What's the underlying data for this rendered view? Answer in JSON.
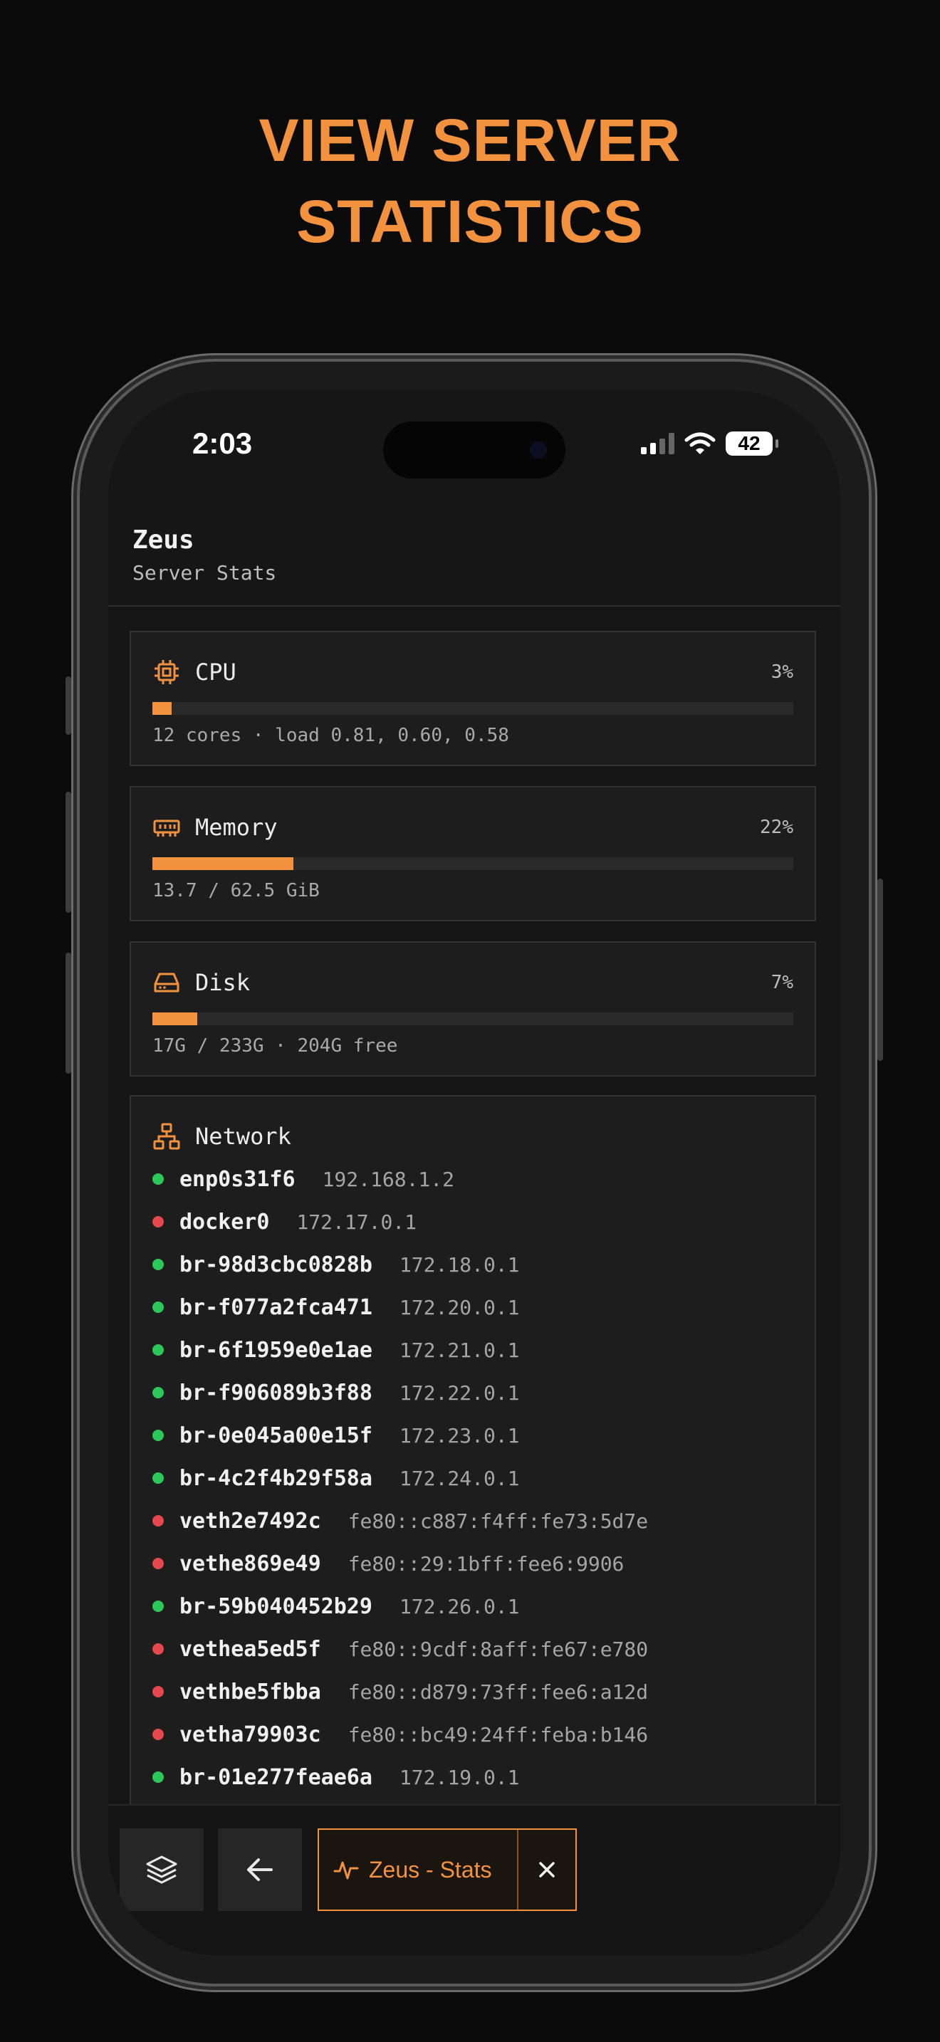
{
  "headline": {
    "line1": "VIEW SERVER",
    "line2": "STATISTICS"
  },
  "status_bar": {
    "time": "2:03",
    "battery": "42"
  },
  "app": {
    "title": "Zeus",
    "subtitle": "Server Stats"
  },
  "cpu": {
    "label": "CPU",
    "percent_text": "3%",
    "percent": 3,
    "detail": "12 cores · load 0.81, 0.60, 0.58"
  },
  "memory": {
    "label": "Memory",
    "percent_text": "22%",
    "percent": 22,
    "detail": "13.7 / 62.5 GiB"
  },
  "disk": {
    "label": "Disk",
    "percent_text": "7%",
    "percent": 7,
    "detail": "17G / 233G · 204G free"
  },
  "network": {
    "label": "Network",
    "interfaces": [
      {
        "name": "enp0s31f6",
        "address": "192.168.1.2",
        "status": "up"
      },
      {
        "name": "docker0",
        "address": "172.17.0.1",
        "status": "down"
      },
      {
        "name": "br-98d3cbc0828b",
        "address": "172.18.0.1",
        "status": "up"
      },
      {
        "name": "br-f077a2fca471",
        "address": "172.20.0.1",
        "status": "up"
      },
      {
        "name": "br-6f1959e0e1ae",
        "address": "172.21.0.1",
        "status": "up"
      },
      {
        "name": "br-f906089b3f88",
        "address": "172.22.0.1",
        "status": "up"
      },
      {
        "name": "br-0e045a00e15f",
        "address": "172.23.0.1",
        "status": "up"
      },
      {
        "name": "br-4c2f4b29f58a",
        "address": "172.24.0.1",
        "status": "up"
      },
      {
        "name": "veth2e7492c",
        "address": "fe80::c887:f4ff:fe73:5d7e",
        "status": "down"
      },
      {
        "name": "vethe869e49",
        "address": "fe80::29:1bff:fee6:9906",
        "status": "down"
      },
      {
        "name": "br-59b040452b29",
        "address": "172.26.0.1",
        "status": "up"
      },
      {
        "name": "vethea5ed5f",
        "address": "fe80::9cdf:8aff:fe67:e780",
        "status": "down"
      },
      {
        "name": "vethbe5fbba",
        "address": "fe80::d879:73ff:fee6:a12d",
        "status": "down"
      },
      {
        "name": "vetha79903c",
        "address": "fe80::bc49:24ff:feba:b146",
        "status": "down"
      },
      {
        "name": "br-01e277feae6a",
        "address": "172.19.0.1",
        "status": "up"
      }
    ]
  },
  "bottom_bar": {
    "active_tab_label": "Zeus - Stats"
  },
  "colors": {
    "accent": "#f2923f",
    "status_up": "#2fc75a",
    "status_down": "#e5484d"
  },
  "icons": {
    "cpu": "cpu-chip-icon",
    "memory": "memory-ram-icon",
    "disk": "disk-drive-icon",
    "network": "network-tree-icon",
    "layers": "layers-icon",
    "back": "arrow-left-icon",
    "activity": "activity-pulse-icon",
    "close": "close-icon"
  }
}
